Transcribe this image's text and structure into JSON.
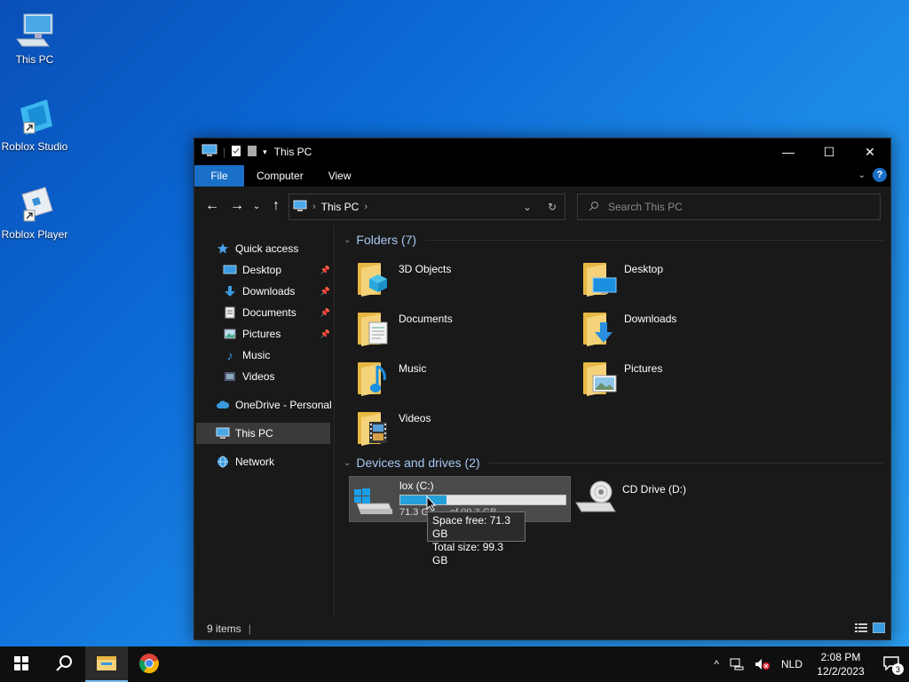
{
  "desktop": {
    "icons": [
      {
        "label": "This PC",
        "icon": "computer-icon"
      },
      {
        "label": "Roblox Studio",
        "icon": "roblox-studio-icon"
      },
      {
        "label": "Roblox Player",
        "icon": "roblox-player-icon"
      }
    ]
  },
  "window": {
    "title": "This PC",
    "controls": {
      "minimize": "—",
      "maximize": "☐",
      "close": "✕"
    },
    "ribbon_tabs": [
      "File",
      "Computer",
      "View"
    ],
    "help": "?",
    "address": {
      "crumb": "This PC",
      "sep": "›"
    },
    "search_placeholder": "Search This PC"
  },
  "sidebar": {
    "items": [
      {
        "label": "Quick access",
        "icon": "star-icon"
      },
      {
        "label": "Desktop",
        "icon": "desktop-icon",
        "pinned": true
      },
      {
        "label": "Downloads",
        "icon": "download-arrow-icon",
        "pinned": true
      },
      {
        "label": "Documents",
        "icon": "document-icon",
        "pinned": true
      },
      {
        "label": "Pictures",
        "icon": "picture-icon",
        "pinned": true
      },
      {
        "label": "Music",
        "icon": "music-note-icon"
      },
      {
        "label": "Videos",
        "icon": "video-icon"
      },
      {
        "label": "OneDrive - Personal",
        "icon": "cloud-icon"
      },
      {
        "label": "This PC",
        "icon": "computer-icon"
      },
      {
        "label": "Network",
        "icon": "network-icon"
      }
    ]
  },
  "main": {
    "folders_header": "Folders (7)",
    "folders": [
      {
        "name": "3D Objects",
        "icon": "3d-objects-folder-icon"
      },
      {
        "name": "Desktop",
        "icon": "desktop-folder-icon"
      },
      {
        "name": "Documents",
        "icon": "documents-folder-icon"
      },
      {
        "name": "Downloads",
        "icon": "downloads-folder-icon"
      },
      {
        "name": "Music",
        "icon": "music-folder-icon"
      },
      {
        "name": "Pictures",
        "icon": "pictures-folder-icon"
      },
      {
        "name": "Videos",
        "icon": "videos-folder-icon"
      }
    ],
    "devices_header": "Devices and drives (2)",
    "drives": [
      {
        "name": "lox (C:)",
        "free_text": "71.3 G",
        "free_text_tail": "of 99.3 GB",
        "used_fraction": 0.282,
        "icon": "windows-drive-icon"
      },
      {
        "name": "CD Drive (D:)",
        "icon": "cd-drive-icon"
      }
    ],
    "tooltip": {
      "line1": "Space free: 71.3 GB",
      "line2": "Total size: 99.3 GB"
    }
  },
  "status": {
    "items": "9 items"
  },
  "taskbar": {
    "lang": "NLD",
    "time": "2:08 PM",
    "date": "12/2/2023",
    "notifications": "3"
  },
  "colors": {
    "accent": "#1a6fc9",
    "folder": "#e7b743",
    "window_bg": "#191919"
  }
}
